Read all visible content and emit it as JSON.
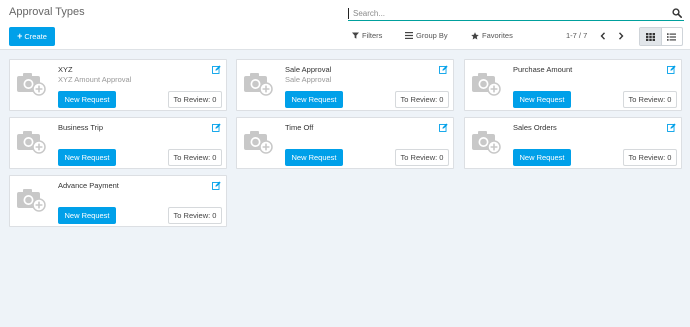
{
  "header": {
    "title": "Approval Types",
    "search_placeholder": "Search...",
    "create_label": "Create",
    "create_icon": "plus",
    "filters_label": "Filters",
    "group_by_label": "Group By",
    "favorites_label": "Favorites",
    "pager_text": "1-7 / 7",
    "active_view": "kanban"
  },
  "colors": {
    "accent": "#00a0e9",
    "search_underline": "#00a09d",
    "edit_icon": "#00a0e9"
  },
  "cards": [
    {
      "title": "XYZ",
      "subtitle": "XYZ Amount Approval",
      "button": "New Request",
      "review": "To Review: 0"
    },
    {
      "title": "Sale Approval",
      "subtitle": "Sale Approval",
      "button": "New Request",
      "review": "To Review: 0"
    },
    {
      "title": "Purchase Amount",
      "subtitle": "",
      "button": "New Request",
      "review": "To Review: 0"
    },
    {
      "title": "Business Trip",
      "subtitle": "",
      "button": "New Request",
      "review": "To Review: 0"
    },
    {
      "title": "Time Off",
      "subtitle": "",
      "button": "New Request",
      "review": "To Review: 0"
    },
    {
      "title": "Sales Orders",
      "subtitle": "",
      "button": "New Request",
      "review": "To Review: 0"
    },
    {
      "title": "Advance Payment",
      "subtitle": "",
      "button": "New Request",
      "review": "To Review: 0"
    }
  ]
}
